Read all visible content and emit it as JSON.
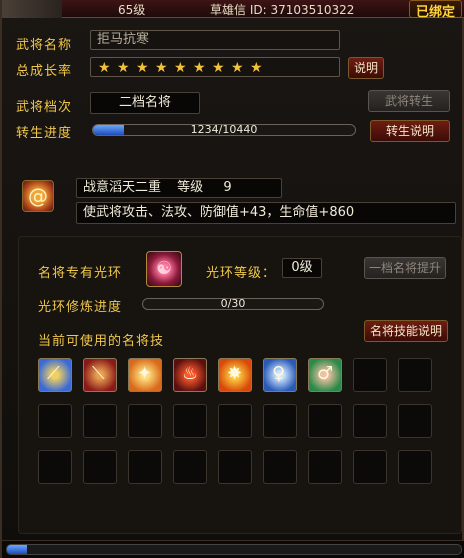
{
  "topbar": {
    "level": "65级",
    "uid": "草雄信 ID: 37103510322",
    "bound_label": "已绑定"
  },
  "general": {
    "name_label": "武将名称",
    "name_value": "拒马抗寒",
    "growth_label": "总成长率",
    "stars_count": 9,
    "stars_total": 9,
    "explain_btn": "说明",
    "grade_label": "武将档次",
    "grade_value": "二档名将",
    "reborn_btn": "武将转生",
    "reborn_progress_label": "转生进度",
    "reborn_progress_text": "1234/10440",
    "reborn_progress_value": 1234,
    "reborn_progress_max": 10440,
    "reborn_explain_btn": "转生说明"
  },
  "buff": {
    "icon": "swirl-icon",
    "name": "战意滔天二重",
    "level_label": "等级",
    "level": "9",
    "desc": "使武将攻击、法攻、防御值+43，生命值+860"
  },
  "aura": {
    "title": "名将专有光环",
    "level_label": "光环等级：",
    "level_value": "0级",
    "upgrade_btn": "一档名将提升",
    "refine_label": "光环修炼进度",
    "refine_text": "0/30",
    "refine_value": 0,
    "refine_max": 30
  },
  "skills": {
    "title": "当前可使用的名将技",
    "explain_btn": "名将技能说明",
    "icons": [
      "sword-slash-icon",
      "red-blade-icon",
      "fire-slash-icon",
      "flame-warrior-icon",
      "blazing-strike-icon",
      "blue-warrior-icon",
      "green-figure-icon"
    ]
  },
  "colors": {
    "label": "#f0c84a",
    "bound": "#ffd33a",
    "button_red": "#6e1d12",
    "progress_blue": "#1f4cb8"
  }
}
